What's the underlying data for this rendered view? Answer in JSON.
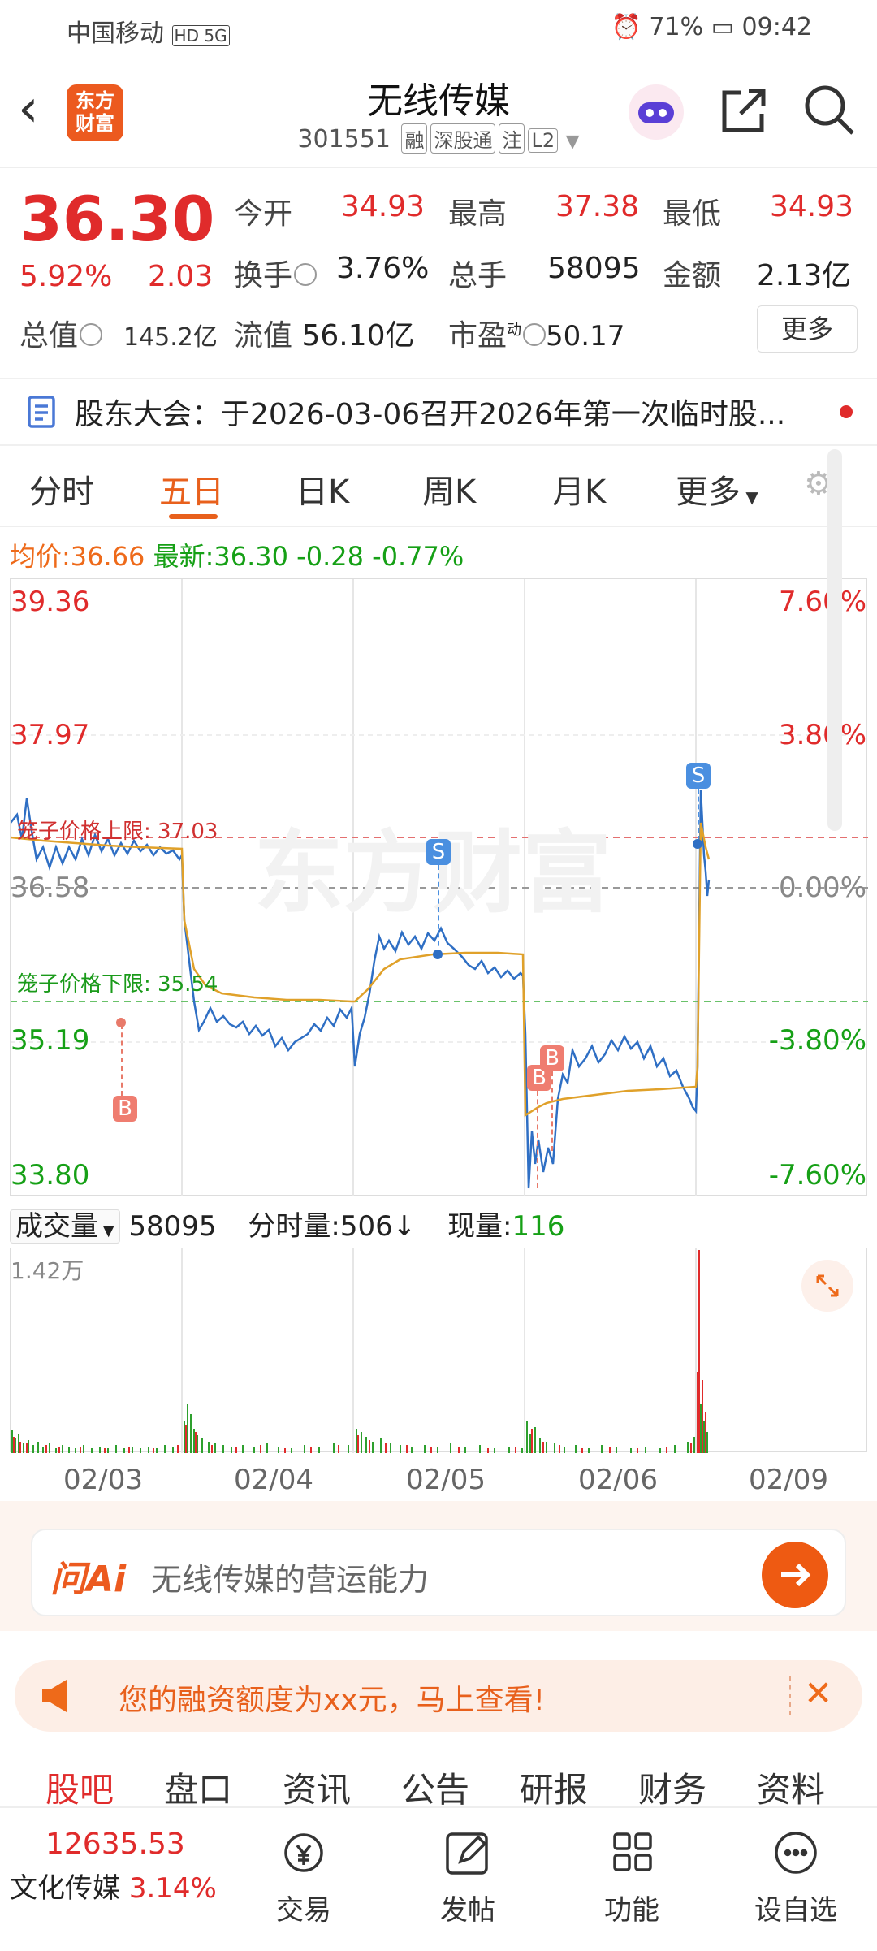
{
  "status_bar": {
    "carrier": "中国移动",
    "signal": "HD 5G",
    "battery": "71%",
    "time": "09:42"
  },
  "header": {
    "title": "无线传媒",
    "code": "301551",
    "tags": [
      "融",
      "深股通",
      "注",
      "L2"
    ],
    "logo_text": "东方财富"
  },
  "quote": {
    "price": "36.30",
    "change_pct": "5.92%",
    "change": "2.03",
    "open_label": "今开",
    "open": "34.93",
    "high_label": "最高",
    "high": "37.38",
    "low_label": "最低",
    "low": "34.93",
    "turnover_label": "换手",
    "turnover": "3.76%",
    "volume_label": "总手",
    "volume": "58095",
    "amount_label": "金额",
    "amount": "2.13亿",
    "mcap_label": "总值",
    "mcap": "145.2亿",
    "float_label": "流值",
    "float": "56.10亿",
    "pe_label": "市盈",
    "pe_sup": "动",
    "pe": "50.17",
    "more": "更多"
  },
  "notice": {
    "text": "股东大会：于2026-03-06召开2026年第一次临时股..."
  },
  "tabs": [
    "分时",
    "五日",
    "日K",
    "周K",
    "月K",
    "更多"
  ],
  "active_tab": "五日",
  "avg_row": {
    "avg_label": "均价:",
    "avg": "36.66",
    "last_label": "最新:",
    "last": "36.30",
    "chg": "-0.28",
    "chg_pct": "-0.77%"
  },
  "chart": {
    "y_left": [
      "39.36",
      "37.97",
      "36.58",
      "35.19",
      "33.80"
    ],
    "y_right": [
      "7.60%",
      "3.80%",
      "0.00%",
      "-3.80%",
      "-7.60%"
    ],
    "upper_limit": "笼子价格上限: 37.03",
    "lower_limit": "笼子价格下限: 35.54",
    "watermark": "东方财富",
    "markers": [
      "B",
      "B",
      "B",
      "S",
      "S"
    ]
  },
  "volume": {
    "label": "成交量",
    "total": "58095",
    "tick_label": "分时量:",
    "tick": "506",
    "now_label": "现量:",
    "now": "116",
    "scale": "1.42万"
  },
  "dates": [
    "02/03",
    "02/04",
    "02/05",
    "02/06",
    "02/09"
  ],
  "ai": {
    "logo": "问Ai",
    "placeholder": "无线传媒的营运能力"
  },
  "promo": {
    "text": "您的融资额度为xx元，马上查看!"
  },
  "sub_tabs": [
    "股吧",
    "盘口",
    "资讯",
    "公告",
    "研报",
    "财务",
    "资料"
  ],
  "bottom": {
    "index_value": "12635.53",
    "index_name": "文化传媒",
    "index_pct": "3.14%",
    "items": [
      "交易",
      "发帖",
      "功能",
      "设自选"
    ]
  }
}
